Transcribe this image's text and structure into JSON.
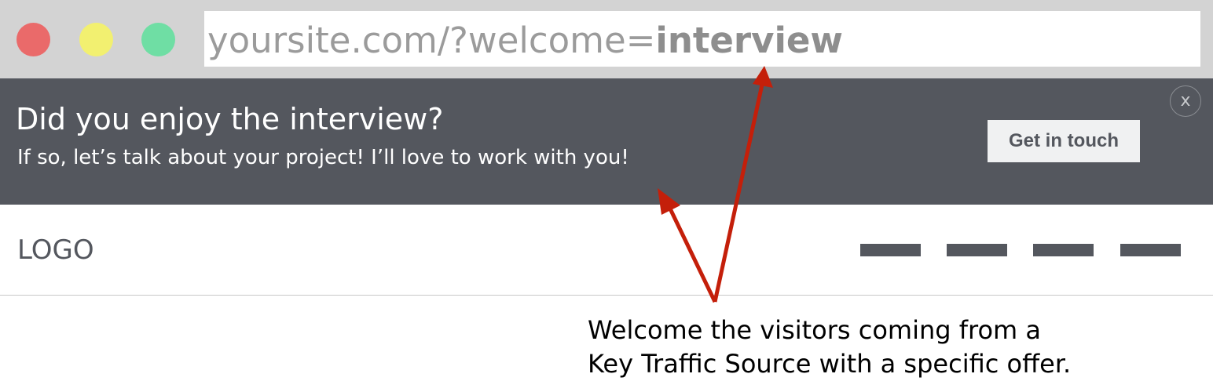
{
  "browser": {
    "window_controls": [
      {
        "name": "close",
        "color": "#ea6a6a"
      },
      {
        "name": "minimize",
        "color": "#f2f070"
      },
      {
        "name": "maximize",
        "color": "#6fdea4"
      }
    ],
    "url_prefix": "yoursite.com/?welcome=",
    "url_param": "interview"
  },
  "banner": {
    "heading": "Did you enjoy the interview?",
    "subtext": "If so, let’s talk about your project! I’ll love to work with you!",
    "cta_label": "Get in touch",
    "close_label": "x",
    "background_color": "#54575e"
  },
  "site_header": {
    "logo": "LOGO",
    "nav_items": [
      "",
      "",
      "",
      ""
    ]
  },
  "annotation": {
    "line1": "Welcome the visitors coming from a",
    "line2": "Key Traffic Source with a specific offer.",
    "arrow_color": "#c41f0a"
  }
}
